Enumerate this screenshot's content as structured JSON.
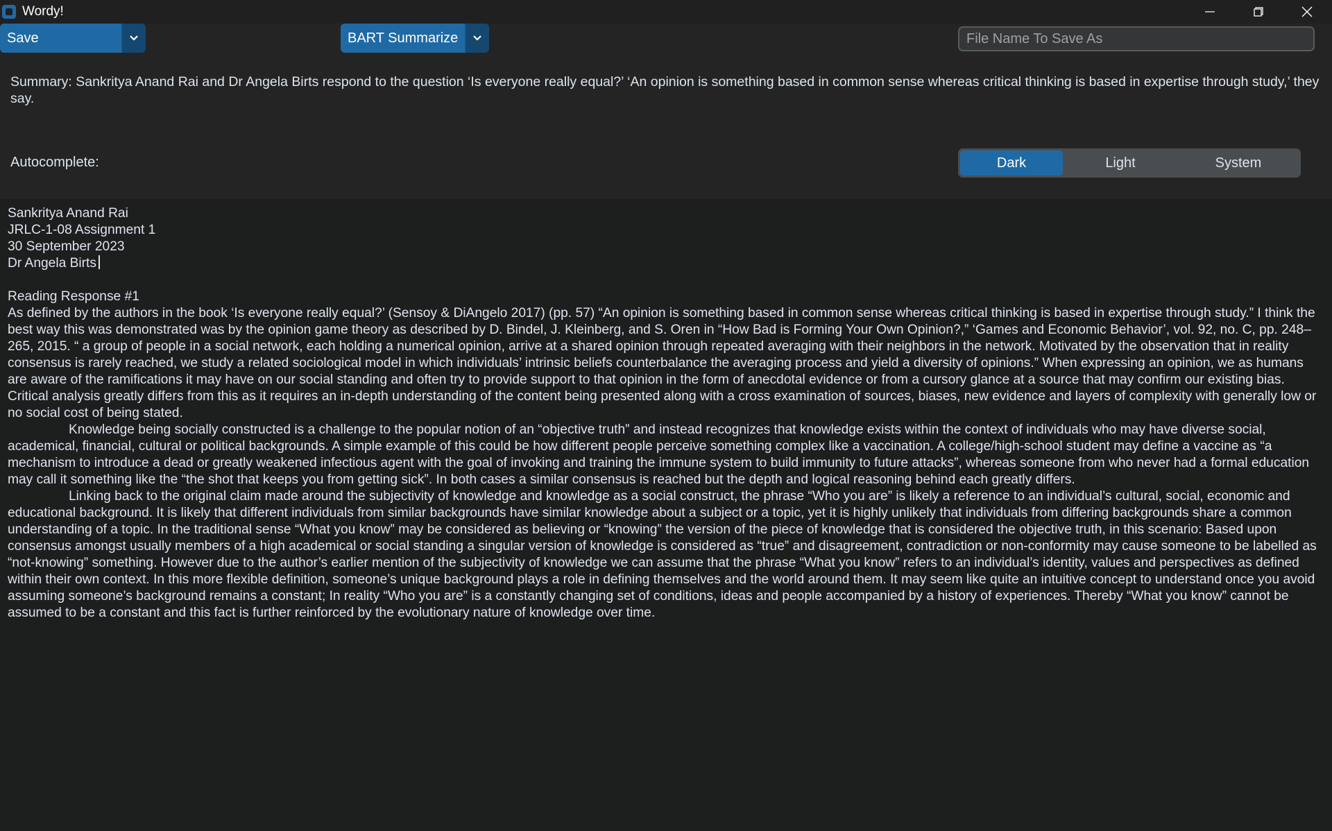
{
  "window": {
    "title": "Wordy!",
    "controls": [
      "minimize-icon",
      "restore-icon",
      "close-icon"
    ]
  },
  "toolbar": {
    "save_label": "Save",
    "summarize_label": "BART Summarize",
    "filename_placeholder": "File Name To Save As",
    "filename_value": ""
  },
  "summary": {
    "text": "Summary: Sankritya Anand Rai and Dr Angela Birts respond to the question ‘Is everyone really equal?’ ‘An opinion is something based in common sense whereas critical thinking is based in expertise through study,’ they say."
  },
  "autocomplete": {
    "label": "Autocomplete:"
  },
  "appearance": {
    "options": [
      "Dark",
      "Light",
      "System"
    ],
    "selected": "Dark"
  },
  "colors": {
    "accent": "#1f6aa5",
    "background": "#242424",
    "textbox_bg": "#1d1e1e"
  },
  "document": {
    "header": [
      "Sankritya Anand Rai",
      "JRLC-1-08 Assignment 1",
      "30 September 2023",
      "Dr Angela Birts"
    ],
    "heading": "Reading Response #1",
    "paragraphs": [
      "As defined by the authors in the book ‘Is everyone really equal?’ (Sensoy & DiAngelo 2017) (pp. 57) “An opinion is something based in common sense whereas critical thinking is based in expertise through study.” I think the best way this was demonstrated was by the opinion game theory as described by D. Bindel, J. Kleinberg, and S. Oren in “How Bad is Forming Your Own Opinion?,” ‘Games and Economic Behavior’, vol. 92, no. C, pp. 248–265, 2015. “ a group of people in a social network, each holding a numerical opinion, arrive at a shared opinion through repeated averaging with their neighbors in the network. Motivated by the observation that in reality consensus is rarely reached, we study a related sociological model in which individuals’ intrinsic beliefs counterbalance the averaging process and yield a diversity of opinions.” When expressing an opinion, we as humans are aware of the ramifications it may have on our social standing and often try to provide support to that opinion in the form of anecdotal evidence or from a cursory glance at a source that may confirm our existing bias. Critical analysis greatly differs from this as it requires an in-depth understanding of the content being presented along with a cross examination of sources, biases, new evidence and layers of complexity with generally low or no social cost of being stated.",
      "Knowledge being socially constructed is a challenge to the popular notion of an “objective truth” and instead recognizes that knowledge exists within the context of individuals who may have diverse social, academical, financial, cultural or political backgrounds. A simple example of this could be how different people perceive something complex like a vaccination. A college/high-school student may define a vaccine as “a mechanism to introduce a dead or greatly weakened infectious agent with the goal of invoking and training the immune system to build immunity to future attacks”, whereas someone from who never had a formal education may call it something like the “the shot that keeps you from getting sick”. In both cases a similar consensus is reached but the depth and logical reasoning behind each greatly differs.",
      "Linking back to the original claim made around the subjectivity of knowledge and knowledge as a social construct, the phrase “Who you are” is likely a reference to an individual’s cultural, social, economic and educational background. It is likely that different individuals from similar backgrounds have similar knowledge about a subject or a topic, yet it is highly unlikely that individuals from differing backgrounds share a common understanding of a topic. In the traditional sense “What you know” may be considered as believing or “knowing” the version of the piece of knowledge that is considered the objective truth, in this scenario: Based upon consensus amongst usually members of a high academical or social standing a singular version of knowledge is considered as “true” and disagreement, contradiction or non-conformity may cause someone to be labelled as “not-knowing” something. However due to the author’s earlier mention of the subjectivity of knowledge we can assume that the phrase “What you know” refers to an individual’s identity, values and perspectives as defined within their own context. In this more flexible definition, someone’s unique background plays a role in defining themselves and the world around them. It may seem like quite an intuitive concept to understand once you avoid assuming someone’s background remains a constant; In reality “Who you are” is a constantly changing set of conditions, ideas and people accompanied by a history of experiences. Thereby “What you know” cannot be assumed to be a constant and this fact is further reinforced by the evolutionary nature of knowledge over time."
    ]
  }
}
